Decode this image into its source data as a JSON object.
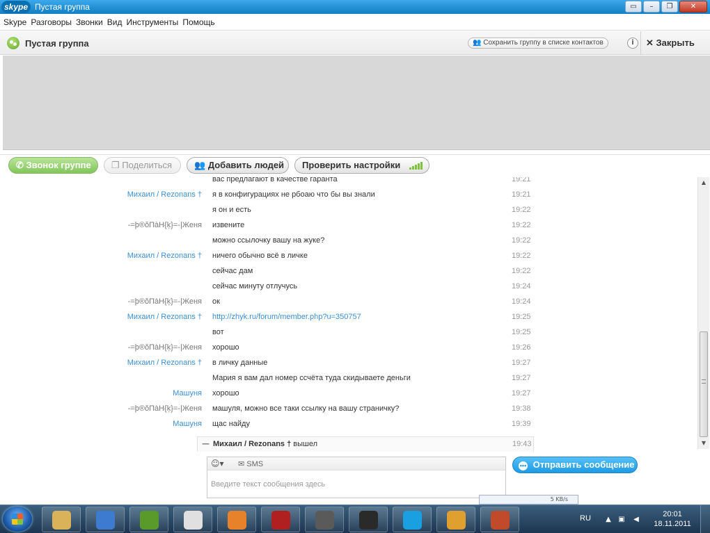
{
  "window": {
    "app_logo": "skype",
    "title": "Пустая группа",
    "controls": [
      "restore-icon",
      "minimize-icon",
      "maximize-icon",
      "close-icon"
    ]
  },
  "menu": [
    "Skype",
    "Разговоры",
    "Звонки",
    "Вид",
    "Инструменты",
    "Помощь"
  ],
  "header": {
    "group_title": "Пустая группа",
    "save_group_label": "Сохранить группу в списке контактов",
    "info_label": "i",
    "close_label": "Закрыть"
  },
  "toolbar": {
    "call_label": "Звонок группе",
    "share_label": "Поделиться",
    "add_people_label": "Добавить людей",
    "check_settings_label": "Проверить настройки"
  },
  "messages": [
    {
      "sender": "",
      "text": "вас предлагают в качестве гаранта",
      "time": "19:21"
    },
    {
      "sender": "Михаил  / Rezonans †",
      "text": "я в конфигурациях не рбоаю что бы вы знали",
      "time": "19:21"
    },
    {
      "sender": "",
      "text": "я он и есть",
      "time": "19:22"
    },
    {
      "sender": "-=þ®ŏПàН{ķ}=-|Женя",
      "text": "извените",
      "time": "19:22"
    },
    {
      "sender": "",
      "text": "можно ссылочку вашу на жуке?",
      "time": "19:22"
    },
    {
      "sender": "Михаил  / Rezonans †",
      "text": "ничего обычно всё в личке",
      "time": "19:22"
    },
    {
      "sender": "",
      "text": "сейчас дам",
      "time": "19:22"
    },
    {
      "sender": "",
      "text": "сейчас минуту отлучусь",
      "time": "19:24"
    },
    {
      "sender": "-=þ®ŏПàН{ķ}=-|Женя",
      "text": "ок",
      "time": "19:24"
    },
    {
      "sender": "Михаил  / Rezonans †",
      "text": "http://zhyk.ru/forum/member.php?u=350757",
      "time": "19:25"
    },
    {
      "sender": "",
      "text": "вот",
      "time": "19:25"
    },
    {
      "sender": "-=þ®ŏПàН{ķ}=-|Женя",
      "text": "хорошо",
      "time": "19:26"
    },
    {
      "sender": "Михаил  / Rezonans †",
      "text": "в личку данные",
      "time": "19:27"
    },
    {
      "sender": "",
      "text": "Мария я вам дал номер ссчёта туда скидываете деньги",
      "time": "19:27"
    },
    {
      "sender": "Машуня",
      "text": "хорошо",
      "time": "19:27"
    },
    {
      "sender": "-=þ®ŏПàН{ķ}=-|Женя",
      "text": "машуля, можно все таки ссылку на вашу страничку?",
      "time": "19:38"
    },
    {
      "sender": "Машуня",
      "text": "щас найду",
      "time": "19:39"
    }
  ],
  "leave_event": {
    "who": "Михаил  / Rezonans †",
    "action": "вышел",
    "time": "19:43"
  },
  "input": {
    "sms_label": "SMS",
    "placeholder": "Введите текст сообщения здесь",
    "send_label": "Отправить сообщение"
  },
  "download_strip": "5 KB/s",
  "taskbar": {
    "apps": [
      "explorer-icon",
      "media-player-icon",
      "utorrent-icon",
      "chrome-icon",
      "firefox-icon",
      "game-icon",
      "warcraft-icon",
      "gg-icon",
      "skype-icon",
      "app-icon",
      "opera-icon"
    ],
    "lang": "RU",
    "time": "20:01",
    "date": "18.11.2011"
  }
}
